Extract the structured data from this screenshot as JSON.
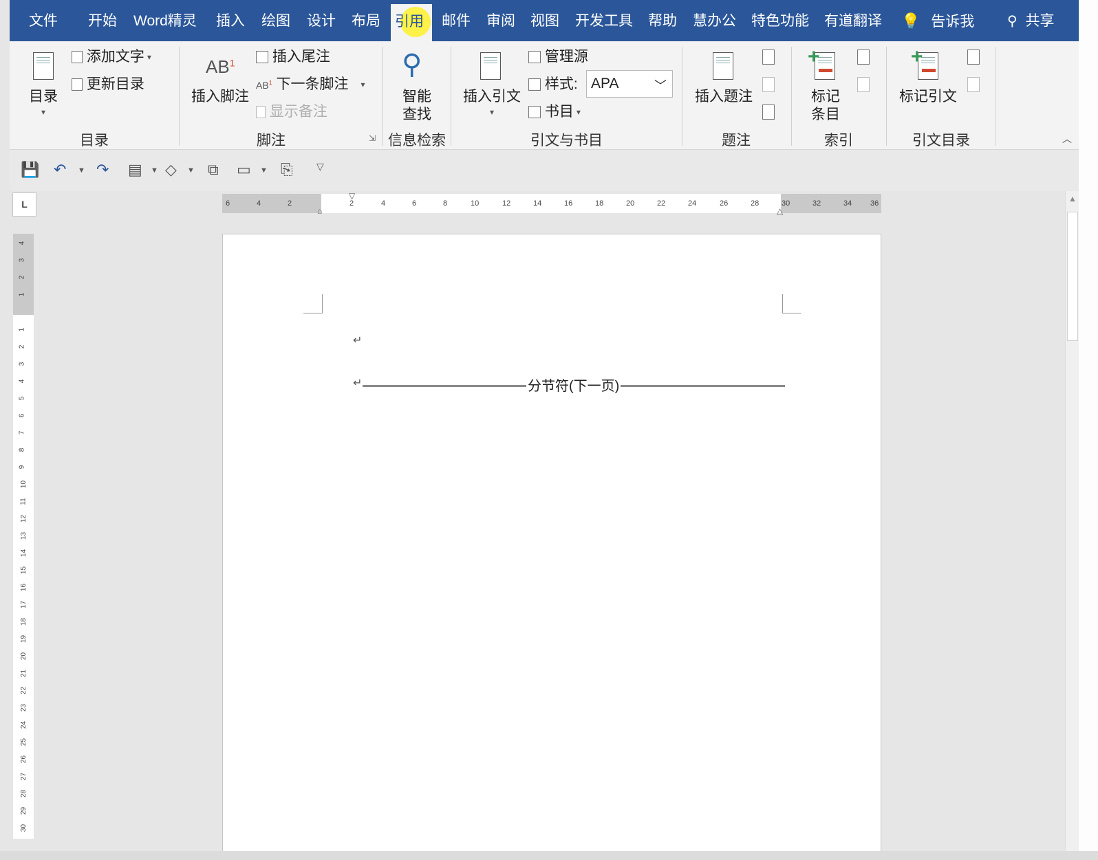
{
  "tabs": [
    "文件",
    "开始",
    "Word精灵",
    "插入",
    "绘图",
    "设计",
    "布局",
    "引用",
    "邮件",
    "审阅",
    "视图",
    "开发工具",
    "帮助",
    "慧办公",
    "特色功能",
    "有道翻译"
  ],
  "active_tab": "引用",
  "tell_me": "告诉我",
  "share": "共享",
  "ribbon": {
    "toc": {
      "big_button": "目录",
      "add_text": "添加文字",
      "update_toc": "更新目录",
      "group_label": "目录"
    },
    "footnotes": {
      "insert_footnote": "插入脚注",
      "insert_endnote": "插入尾注",
      "next_footnote": "下一条脚注",
      "show_notes": "显示备注",
      "group_label": "脚注"
    },
    "research": {
      "smart_lookup_line1": "智能",
      "smart_lookup_line2": "查找",
      "group_label": "信息检索"
    },
    "citations": {
      "insert_citation": "插入引文",
      "manage_sources": "管理源",
      "style_label": "样式:",
      "style_value": "APA",
      "bibliography": "书目",
      "group_label": "引文与书目"
    },
    "captions": {
      "insert_caption": "插入题注",
      "group_label": "题注"
    },
    "index": {
      "mark_entry_line1": "标记",
      "mark_entry_line2": "条目",
      "group_label": "索引"
    },
    "toa": {
      "mark_citation": "标记引文",
      "group_label": "引文目录"
    }
  },
  "ruler": {
    "h_numbers": [
      "6",
      "4",
      "2",
      "2",
      "4",
      "6",
      "8",
      "10",
      "12",
      "14",
      "16",
      "18",
      "20",
      "22",
      "24",
      "26",
      "28",
      "30",
      "32",
      "34",
      "36"
    ],
    "v_numbers": [
      "4",
      "3",
      "2",
      "1",
      "1",
      "2",
      "3",
      "4",
      "5",
      "6",
      "7",
      "8",
      "9",
      "10",
      "11",
      "12",
      "13",
      "14",
      "15",
      "16",
      "17",
      "18",
      "19",
      "20",
      "21",
      "22",
      "23",
      "24",
      "25",
      "26",
      "27",
      "28",
      "29",
      "30"
    ]
  },
  "document": {
    "paragraph_mark": "↵",
    "section_break_label": "分节符(下一页)"
  },
  "colors": {
    "title_bar": "#2b579a",
    "ribbon_bg": "#f3f3f3",
    "accent_red": "#d04a2f",
    "accent_green": "#3a9a5b"
  }
}
